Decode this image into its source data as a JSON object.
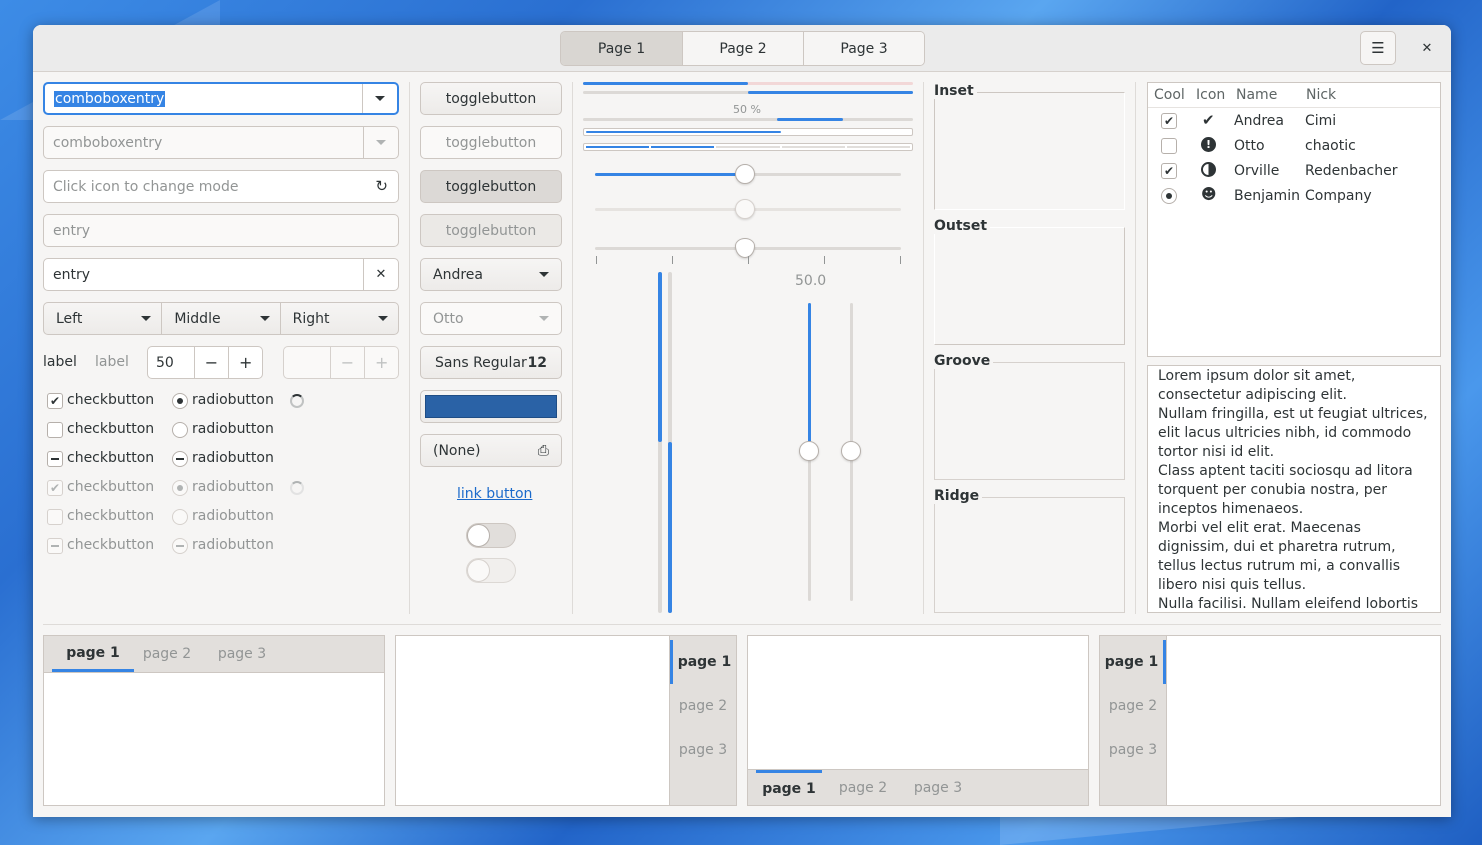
{
  "header": {
    "tabs": [
      "Page 1",
      "Page 2",
      "Page 3"
    ],
    "menu_icon": "hamburger-menu-icon",
    "close_icon": "close-icon"
  },
  "col1": {
    "combo1": "comboboxentry",
    "combo2": "comboboxentry",
    "mode_placeholder": "Click icon to change mode",
    "entry_placeholder": "entry",
    "entry_value": "entry",
    "linked": [
      "Left",
      "Middle",
      "Right"
    ],
    "label1": "label",
    "label2": "label",
    "spin_value": "50",
    "check_label": "checkbutton",
    "radio_label": "radiobutton"
  },
  "col2": {
    "toggle": "togglebutton",
    "combo_andrea": "Andrea",
    "combo_otto": "Otto",
    "font_name": "Sans Regular",
    "font_size": "12",
    "color_hex": "#2a62a6",
    "file_chooser": "(None)",
    "link": "link button"
  },
  "col3": {
    "progress_text": "50 %",
    "scale_value": "50.0",
    "scale_fraction": 0.5,
    "vscale_fraction": 0.5
  },
  "frames": [
    "Inset",
    "Outset",
    "Groove",
    "Ridge"
  ],
  "tree": {
    "columns": [
      "Cool",
      "Icon",
      "Name",
      "Nick"
    ],
    "rows": [
      {
        "name": "Andrea",
        "nick": "Cimi",
        "cool": "checked",
        "icon": "check-circle-icon"
      },
      {
        "name": "Otto",
        "nick": "chaotic",
        "cool": "unchecked",
        "icon": "exclamation-circle-icon"
      },
      {
        "name": "Orville",
        "nick": "Redenbacher",
        "cool": "checked",
        "icon": "half-moon-icon"
      },
      {
        "name": "Benjamin",
        "nick": "Company",
        "cool": "radio",
        "icon": "face-icon"
      }
    ]
  },
  "text_view": "Lorem ipsum dolor sit amet, consectetur adipiscing elit.\nNullam fringilla, est ut feugiat ultrices, elit lacus ultricies nibh, id commodo tortor nisi id elit.\nClass aptent taciti sociosqu ad litora torquent per conubia nostra, per inceptos himenaeos.\nMorbi vel elit erat. Maecenas dignissim, dui et pharetra rutrum, tellus lectus rutrum mi, a convallis libero nisi quis tellus.\nNulla facilisi. Nullam eleifend lobortis",
  "notebooks": {
    "tabs": [
      "page 1",
      "page 2",
      "page 3"
    ]
  }
}
